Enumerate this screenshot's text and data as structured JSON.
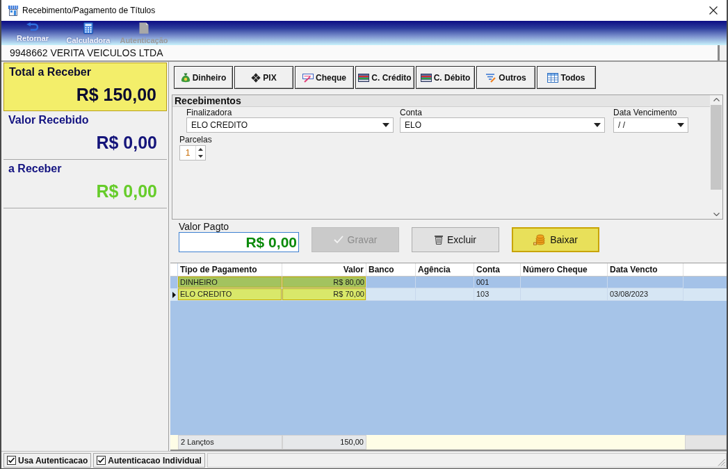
{
  "window": {
    "title": "Recebimento/Pagamento de Títulos"
  },
  "toolbar": [
    {
      "kind": "back",
      "label": "Retornar",
      "disabled": false
    },
    {
      "kind": "calculator",
      "label": "Calculadora",
      "disabled": false
    },
    {
      "kind": "authenticate",
      "label": "Autenticação",
      "disabled": true
    }
  ],
  "customer": "9948662 VERITA VEICULOS LTDA",
  "summary": [
    {
      "kind": "total",
      "label": "Total a Receber",
      "value": "R$ 150,00"
    },
    {
      "kind": "received",
      "label": "Valor Recebido",
      "value": "R$ 0,00"
    },
    {
      "kind": "remaining",
      "label": "a Receber",
      "value": "R$ 0,00"
    }
  ],
  "payment_types": [
    {
      "kind": "cash",
      "label": "Dinheiro"
    },
    {
      "kind": "pix",
      "label": "PIX"
    },
    {
      "kind": "check",
      "label": "Cheque"
    },
    {
      "kind": "credit",
      "label": "C. Crédito"
    },
    {
      "kind": "debit",
      "label": "C. Débito"
    },
    {
      "kind": "other",
      "label": "Outros"
    },
    {
      "kind": "all",
      "label": "Todos"
    }
  ],
  "receipts": {
    "title": "Recebimentos",
    "fields": [
      {
        "label": "Finalizadora",
        "value": "ELO CREDITO"
      },
      {
        "label": "Conta",
        "value": "ELO"
      },
      {
        "label": "Data Vencimento",
        "value": "/ /"
      }
    ],
    "installments": {
      "label": "Parcelas",
      "value": "1"
    }
  },
  "payment": {
    "label": "Valor Pagto",
    "value": "R$ 0,00"
  },
  "actions": [
    {
      "kind": "save",
      "label": "Gravar",
      "disabled": true
    },
    {
      "kind": "delete",
      "label": "Excluir",
      "disabled": false
    },
    {
      "kind": "settle",
      "label": "Baixar",
      "disabled": false
    }
  ],
  "table": {
    "columns": [
      "Tipo de Pagamento",
      "Valor",
      "Banco",
      "Agência",
      "Conta",
      "Número Cheque",
      "Data Vencto"
    ],
    "rows": [
      {
        "selected": false,
        "cells": [
          "DINHEIRO",
          "R$ 80,00",
          null,
          null,
          "001",
          null,
          null
        ]
      },
      {
        "selected": true,
        "cells": [
          "ELO CREDITO",
          "R$ 70,00",
          null,
          null,
          "103",
          null,
          "03/08/2023"
        ]
      }
    ],
    "footer": {
      "count": "2 Lançtos",
      "total": "150,00"
    }
  },
  "status_bar": {
    "checkboxes": [
      {
        "label": "Usa Autenticacao",
        "checked": true
      },
      {
        "label": "Autenticacao Individual",
        "checked": true
      }
    ]
  }
}
